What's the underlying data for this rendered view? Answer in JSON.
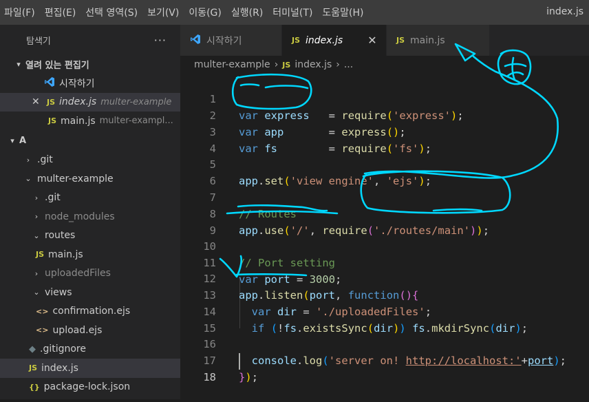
{
  "menubar": {
    "items": [
      "파일(F)",
      "편집(E)",
      "선택 영역(S)",
      "보기(V)",
      "이동(G)",
      "실행(R)",
      "터미널(T)",
      "도움말(H)"
    ],
    "window_title": "index.js"
  },
  "sidebar": {
    "title": "탐색기",
    "more": "···",
    "open_editors": {
      "title": "열려 있는 편집기",
      "items": [
        {
          "label": "시작하기",
          "desc": ""
        },
        {
          "label": "index.js",
          "desc": "multer-example"
        },
        {
          "label": "main.js",
          "desc": "multer-exampl..."
        }
      ]
    },
    "folder": {
      "title": "A",
      "items": [
        {
          "label": ".git",
          "kind": "folder-closed"
        },
        {
          "label": "multer-example",
          "kind": "folder-open"
        },
        {
          "label": ".git",
          "kind": "folder-closed"
        },
        {
          "label": "node_modules",
          "kind": "folder-closed"
        },
        {
          "label": "routes",
          "kind": "folder-open"
        },
        {
          "label": "main.js",
          "kind": "js"
        },
        {
          "label": "uploadedFiles",
          "kind": "folder-closed"
        },
        {
          "label": "views",
          "kind": "folder-open"
        },
        {
          "label": "confirmation.ejs",
          "kind": "ejs"
        },
        {
          "label": "upload.ejs",
          "kind": "ejs"
        },
        {
          "label": ".gitignore",
          "kind": "git"
        },
        {
          "label": "index.js",
          "kind": "js"
        },
        {
          "label": "package-lock.json",
          "kind": "json"
        }
      ]
    }
  },
  "tabs": [
    {
      "label": "시작하기",
      "active": false
    },
    {
      "label": "index.js",
      "active": true,
      "close": "✕"
    },
    {
      "label": "main.js",
      "active": false
    }
  ],
  "breadcrumb": [
    "multer-example",
    "index.js",
    "..."
  ],
  "editor": {
    "line_numbers": [
      "1",
      "2",
      "3",
      "4",
      "5",
      "6",
      "7",
      "8",
      "9",
      "10",
      "11",
      "12",
      "13",
      "14",
      "15",
      "16",
      "17",
      "18"
    ],
    "current_line": "18"
  },
  "colors": {
    "keyword": "#569cd6",
    "variable": "#9cdcfe",
    "function": "#dcdcaa",
    "string": "#ce9178",
    "number": "#b5cea8",
    "comment": "#6a9955",
    "annotation_ink": "#00d8ff"
  },
  "icons": {
    "vscode": "vscode-logo-icon",
    "close": "close-icon",
    "chevron": "chevron-icon",
    "more": "more-icon"
  }
}
